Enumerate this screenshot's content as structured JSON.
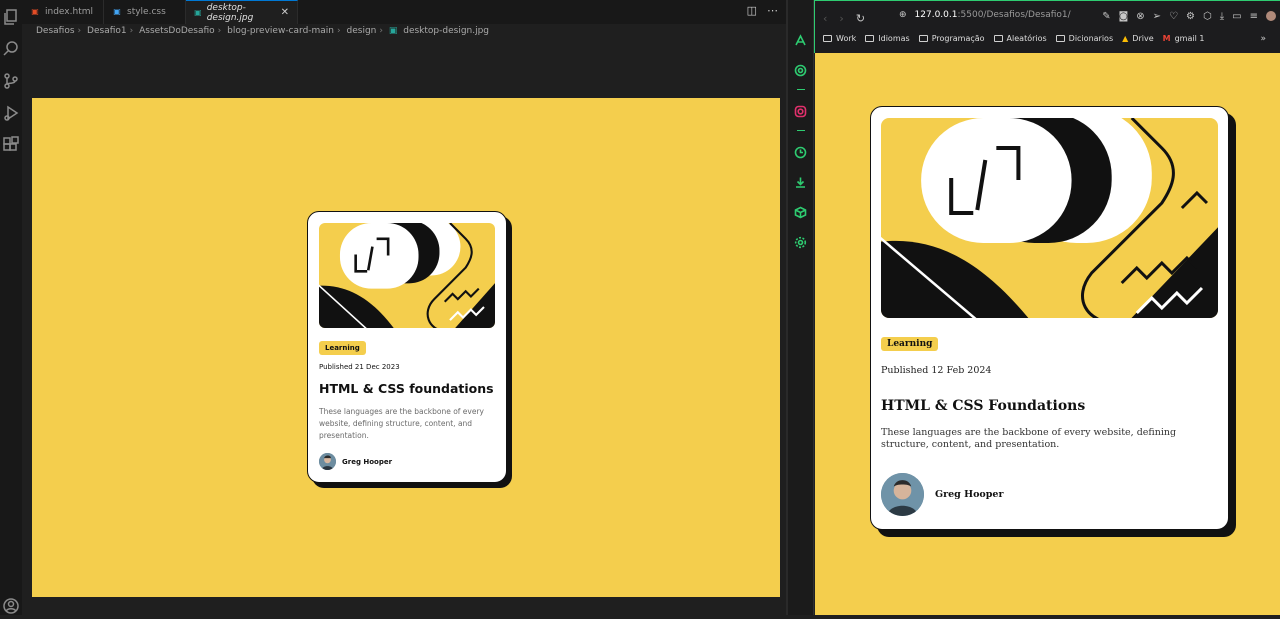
{
  "vscode": {
    "tabs": [
      {
        "label": "index.html",
        "icon": "html-file-icon"
      },
      {
        "label": "style.css",
        "icon": "css-file-icon"
      },
      {
        "label": "desktop-design.jpg",
        "icon": "image-file-icon"
      }
    ],
    "active_tab": "desktop-design.jpg",
    "breadcrumb": [
      "Desafios",
      "Desafio1",
      "AssetsDoDesafio",
      "blog-preview-card-main",
      "design",
      "desktop-design.jpg"
    ],
    "design_card": {
      "tag": "Learning",
      "published": "Published 21 Dec 2023",
      "title": "HTML & CSS foundations",
      "description": "These languages are the backbone of every website, defining structure, content, and presentation.",
      "author": "Greg Hooper"
    }
  },
  "browser": {
    "url_host": "127.0.0.1",
    "url_path": ":5500/Desafios/Desafio1/",
    "bookmarks": [
      {
        "label": "Work",
        "icon": "folder-icon"
      },
      {
        "label": "Idiomas",
        "icon": "folder-icon"
      },
      {
        "label": "Programação",
        "icon": "folder-icon"
      },
      {
        "label": "Aleatórios",
        "icon": "folder-icon"
      },
      {
        "label": "Dicionarios",
        "icon": "folder-icon"
      },
      {
        "label": "Drive",
        "icon": "google-drive-icon"
      },
      {
        "label": "gmail 1",
        "icon": "gmail-icon"
      }
    ],
    "card": {
      "tag": "Learning",
      "published": "Published 12 Feb 2024",
      "title": "HTML & CSS Foundations",
      "description": "These languages are the backbone of every website, defining structure, content, and presentation.",
      "author": "Greg Hooper"
    }
  },
  "colors": {
    "yellow": "#f4ce4d",
    "ink": "#111111",
    "accent_green": "#2ecc71"
  }
}
